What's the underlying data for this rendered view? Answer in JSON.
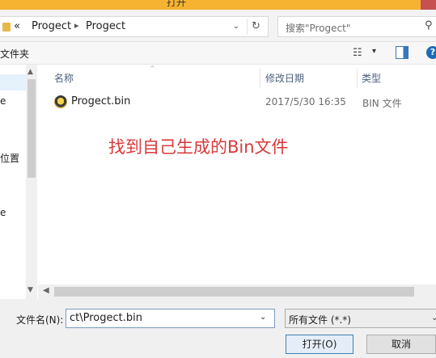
{
  "window": {
    "title": "打开"
  },
  "address": {
    "prefix": "«",
    "segments": [
      "Progect",
      "Progect"
    ],
    "separator": "▸",
    "dropdown_glyph": "⌄",
    "refresh_glyph": "↻"
  },
  "search": {
    "placeholder": "搜索\"Progect\"",
    "icon_glyph": "⚲"
  },
  "toolbar": {
    "new_folder": "文件夹",
    "view_glyph": "☷",
    "view_dropdown": "▾",
    "help_glyph": "?"
  },
  "nav": {
    "items": [
      "e",
      "位置",
      "e"
    ],
    "scroll_up": "▲",
    "scroll_down": "▼"
  },
  "columns": {
    "name": "名称",
    "date": "修改日期",
    "type": "类型",
    "sort_glyph": "^"
  },
  "files": [
    {
      "name": "Progect.bin",
      "date": "2017/5/30 16:35",
      "type": "BIN 文件"
    }
  ],
  "annotation": "找到自己生成的Bin文件",
  "hscroll": {
    "left": "◀"
  },
  "bottom": {
    "filename_label": "文件名(N):",
    "filename_value": "ct\\Progect.bin",
    "filename_dropdown": "⌄",
    "filetype_value": "所有文件 (*.*)",
    "filetype_dropdown": "⌄",
    "open_label": "打开(O)",
    "cancel_label": "取消"
  },
  "colors": {
    "titlebar": "#f5b331",
    "annotation": "#d9393b",
    "column_header": "#4c607a",
    "selection": "#e5f1fb"
  }
}
